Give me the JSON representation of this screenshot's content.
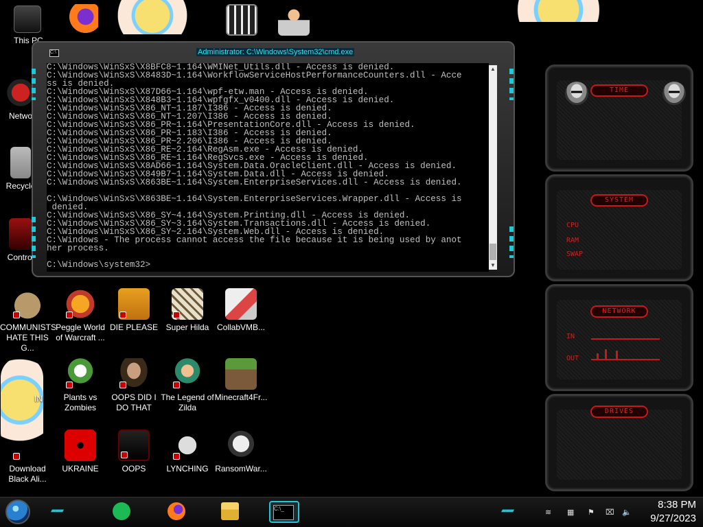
{
  "desktop": {
    "left_labels": {
      "this_pc": "This PC",
      "network": "Netwo",
      "recycle": "Recycle",
      "control": "Control",
      "anime": "IN"
    },
    "icons": [
      {
        "label": "COMMUNISTS HATE THIS G...",
        "icon": "money-bag-icon"
      },
      {
        "label": "Peggle World of Warcraft ...",
        "icon": "peggle-icon"
      },
      {
        "label": "DIE PLEASE",
        "icon": "die-icon"
      },
      {
        "label": "Super Hilda",
        "icon": "hilda-icon"
      },
      {
        "label": "CollabVMB...",
        "icon": "collabvm-icon"
      },
      {
        "label": "Plants vs Zombies",
        "icon": "plants-vs-zombies-icon"
      },
      {
        "label": "OOPS DID I DO THAT",
        "icon": "portrait-icon"
      },
      {
        "label": "The Legend of Zilda",
        "icon": "zilda-icon"
      },
      {
        "label": "Minecraft4Fr...",
        "icon": "minecraft-icon"
      },
      {
        "label": "Download Black Ali...",
        "icon": "anime-icon"
      },
      {
        "label": "UKRAINE",
        "icon": "radiation-icon"
      },
      {
        "label": "OOPS",
        "icon": "alienware-icon"
      },
      {
        "label": "LYNCHING",
        "icon": "lynching-icon"
      },
      {
        "label": "RansomWar...",
        "icon": "skull-icon"
      }
    ]
  },
  "cmd": {
    "title": "Administrator: C:\\Windows\\System32\\cmd.exe",
    "lines": [
      "C:\\Windows\\WinSxS\\X8BFC8~1.164\\WMINet_Utils.dll - Access is denied.",
      "C:\\Windows\\WinSxS\\X8483D~1.164\\WorkflowServiceHostPerformanceCounters.dll - Acce",
      "ss is denied.",
      "C:\\Windows\\WinSxS\\X87D66~1.164\\wpf-etw.man - Access is denied.",
      "C:\\Windows\\WinSxS\\X848B3~1.164\\wpfgfx_v0400.dll - Access is denied.",
      "C:\\Windows\\WinSxS\\X86_NT~1.187\\I386 - Access is denied.",
      "C:\\Windows\\WinSxS\\X86_NT~1.207\\I386 - Access is denied.",
      "C:\\Windows\\WinSxS\\X86_PR~1.164\\PresentationCore.dll - Access is denied.",
      "C:\\Windows\\WinSxS\\X86_PR~1.183\\I386 - Access is denied.",
      "C:\\Windows\\WinSxS\\X86_PR~2.206\\I386 - Access is denied.",
      "C:\\Windows\\WinSxS\\X86_RE~2.164\\RegAsm.exe - Access is denied.",
      "C:\\Windows\\WinSxS\\X86_RE~1.164\\RegSvcs.exe - Access is denied.",
      "C:\\Windows\\WinSxS\\X8AD66~1.164\\System.Data.OracleClient.dll - Access is denied.",
      "C:\\Windows\\WinSxS\\X849B7~1.164\\System.Data.dll - Access is denied.",
      "C:\\Windows\\WinSxS\\X863BE~1.164\\System.EnterpriseServices.dll - Access is denied.",
      "",
      "C:\\Windows\\WinSxS\\X863BE~1.164\\System.EnterpriseServices.Wrapper.dll - Access is",
      " denied.",
      "C:\\Windows\\WinSxS\\X86_SY~4.164\\System.Printing.dll - Access is denied.",
      "C:\\Windows\\WinSxS\\X86_SY~3.164\\System.Transactions.dll - Access is denied.",
      "C:\\Windows\\WinSxS\\X86_SY~2.164\\System.Web.dll - Access is denied.",
      "C:\\Windows - The process cannot access the file because it is being used by anot",
      "her process.",
      "",
      "C:\\Windows\\system32>"
    ]
  },
  "gadgets": {
    "time": {
      "title": "TIME"
    },
    "system": {
      "title": "SYSTEM",
      "labels": [
        "CPU",
        "RAM",
        "SWAP"
      ]
    },
    "network": {
      "title": "NETWORK",
      "labels": [
        "IN",
        "OUT"
      ]
    },
    "drives": {
      "title": "DRIVES"
    }
  },
  "taskbar": {
    "apps": [
      {
        "icon": "spotify-icon"
      },
      {
        "icon": "firefox-icon"
      },
      {
        "icon": "file-explorer-icon"
      },
      {
        "icon": "cmd-icon",
        "active": true
      }
    ],
    "clock": {
      "time": "8:38 PM",
      "date": "9/27/2023"
    }
  },
  "colors": {
    "accent_teal": "#1ec8d8",
    "gadget_red": "#c81818",
    "cmd_text": "#c0c0c0"
  }
}
